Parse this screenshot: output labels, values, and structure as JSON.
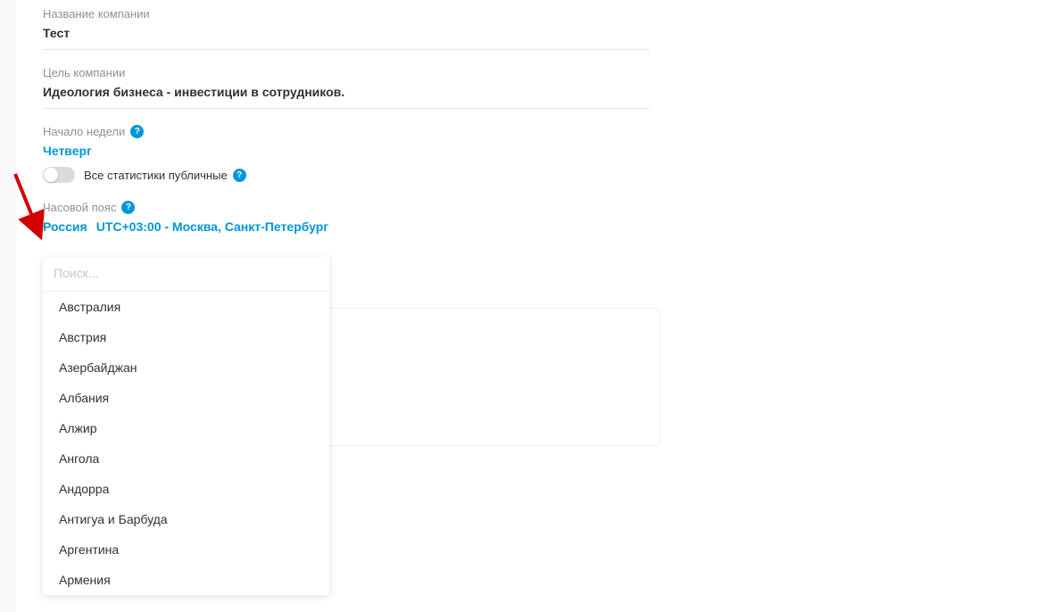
{
  "company_name": {
    "label": "Название компании",
    "value": "Тест"
  },
  "company_goal": {
    "label": "Цель компании",
    "value": "Идеология бизнеса - инвестиции в сотрудников."
  },
  "week_start": {
    "label": "Начало недели",
    "value": "Четверг"
  },
  "public_stats": {
    "label": "Все статистики публичные"
  },
  "timezone": {
    "label": "Часовой пояс",
    "country": "Россия",
    "value": "UTC+03:00 - Москва, Санкт-Петербург"
  },
  "dropdown": {
    "search_placeholder": "Поиск...",
    "items": [
      "Австралия",
      "Австрия",
      "Азербайджан",
      "Албания",
      "Алжир",
      "Ангола",
      "Андорра",
      "Антигуа и Барбуда",
      "Аргентина",
      "Армения"
    ]
  }
}
